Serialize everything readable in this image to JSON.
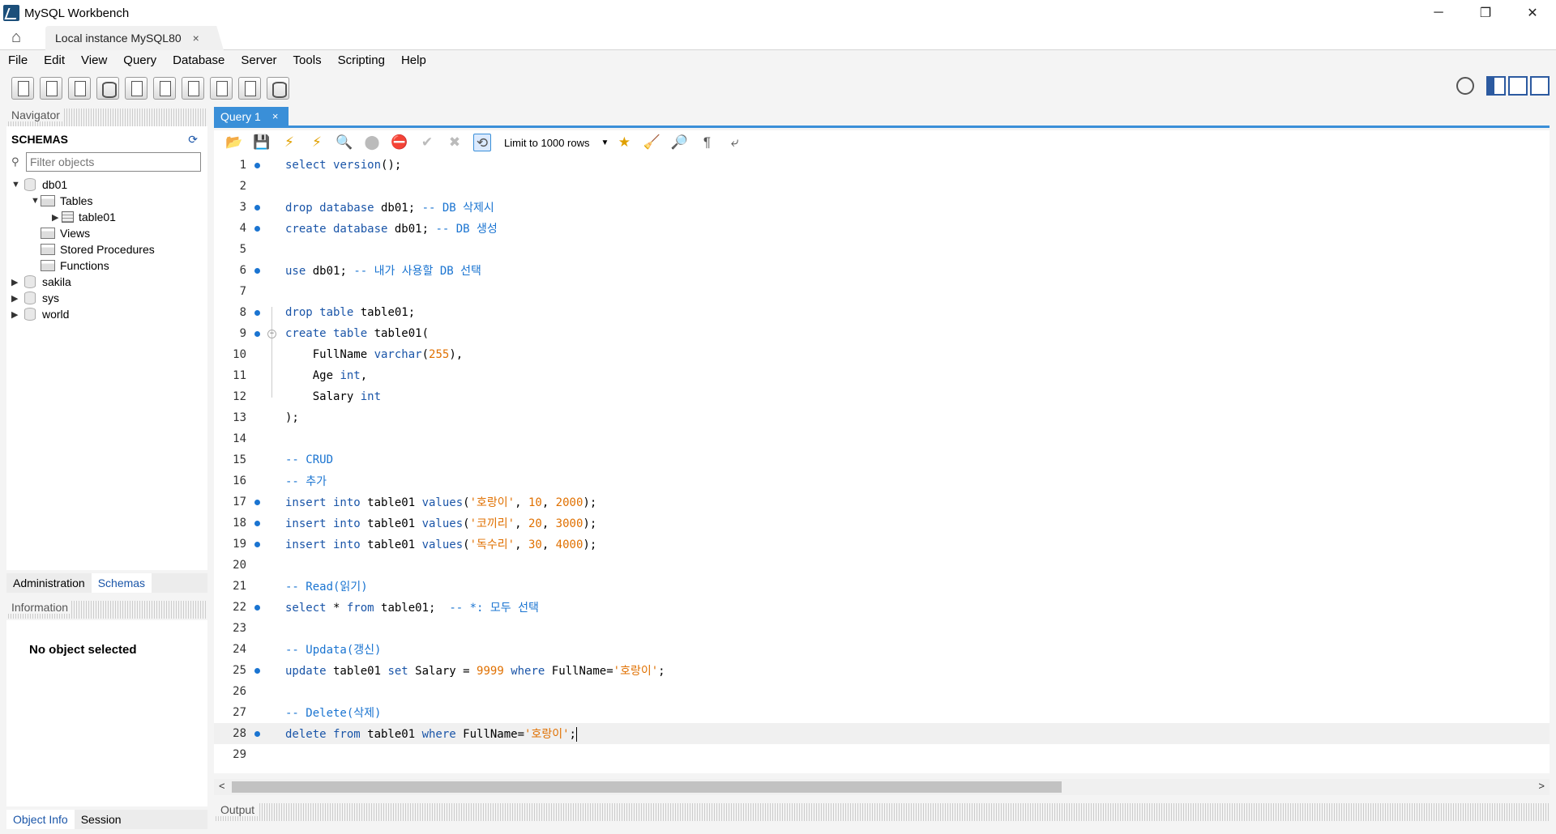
{
  "window": {
    "title": "MySQL Workbench",
    "controls": [
      "─",
      "❐",
      "✕"
    ]
  },
  "connection_tab": {
    "label": "Local instance MySQL80",
    "close": "×"
  },
  "menu": [
    "File",
    "Edit",
    "View",
    "Query",
    "Database",
    "Server",
    "Tools",
    "Scripting",
    "Help"
  ],
  "navigator": {
    "header": "Navigator",
    "schemas_title": "SCHEMAS",
    "filter_placeholder": "Filter objects",
    "tree": {
      "db01": "db01",
      "tables": "Tables",
      "table01": "table01",
      "views": "Views",
      "stored_procedures": "Stored Procedures",
      "functions": "Functions",
      "sakila": "sakila",
      "sys": "sys",
      "world": "world"
    },
    "tabs": {
      "administration": "Administration",
      "schemas": "Schemas"
    }
  },
  "information": {
    "header": "Information",
    "message": "No object selected",
    "tabs": {
      "object_info": "Object Info",
      "session": "Session"
    }
  },
  "query_tab": {
    "label": "Query 1",
    "close": "×"
  },
  "editor_toolbar": {
    "limit_label": "Limit to 1000 rows"
  },
  "output": {
    "header": "Output"
  },
  "colors": {
    "accent": "#3a8fd8",
    "keyword": "#1a55a8",
    "string": "#e07000",
    "comment": "#1a74d1"
  }
}
